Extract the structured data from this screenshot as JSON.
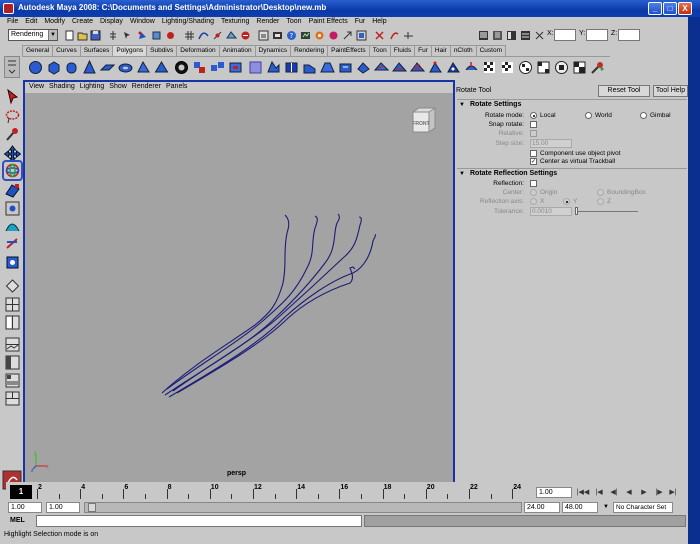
{
  "window": {
    "title": "Autodesk Maya 2008: C:\\Documents and Settings\\Administrator\\Desktop\\new.mb",
    "minimize": "_",
    "maximize": "□",
    "close": "X"
  },
  "menubar": [
    "File",
    "Edit",
    "Modify",
    "Create",
    "Display",
    "Window",
    "Lighting/Shading",
    "Texturing",
    "Render",
    "Toon",
    "Paint Effects",
    "Fur",
    "Help"
  ],
  "statusline": {
    "mode": "Rendering",
    "x_label": "X:",
    "y_label": "Y:",
    "z_label": "Z:"
  },
  "shelf_tabs": [
    "General",
    "Curves",
    "Surfaces",
    "Polygons",
    "Subdivs",
    "Deformation",
    "Animation",
    "Dynamics",
    "Rendering",
    "PaintEffects",
    "Toon",
    "Fluids",
    "Fur",
    "Hair",
    "nCloth",
    "Custom"
  ],
  "shelf_active_tab": "Polygons",
  "viewport": {
    "menu": [
      "View",
      "Shading",
      "Lighting",
      "Show",
      "Renderer",
      "Panels"
    ],
    "camera_label": "persp",
    "viewcube_label": "FRONT",
    "axis_y": "y",
    "axis_x": "x",
    "axis_z": "z"
  },
  "tool_settings": {
    "title": "Rotate Tool",
    "reset_button": "Reset Tool",
    "help_button": "Tool Help",
    "rotate_settings": {
      "header": "Rotate Settings",
      "rotate_mode_label": "Rotate mode:",
      "mode_local": "Local",
      "mode_world": "World",
      "mode_gimbal": "Gimbal",
      "snap_rotate_label": "Snap rotate:",
      "relative_label": "Relative:",
      "step_size_label": "Step size:",
      "step_size_value": "15.00",
      "component_pivot_label": "Component use object pivot",
      "virtual_trackball_label": "Center as virtual Trackball"
    },
    "reflection_settings": {
      "header": "Rotate Reflection Settings",
      "reflection_label": "Reflection:",
      "center_label": "Center:",
      "center_origin": "Origin",
      "center_bbox": "BoundingBox",
      "axis_label": "Reflection axis:",
      "axis_x": "X",
      "axis_y": "Y",
      "axis_z": "Z",
      "tolerance_label": "Tolerance:",
      "tolerance_value": "0.0010"
    }
  },
  "timeline": {
    "current_frame": "1",
    "ticks": [
      "2",
      "4",
      "6",
      "8",
      "10",
      "12",
      "14",
      "16",
      "18",
      "20",
      "22",
      "24"
    ],
    "current_frame_field": "1.00",
    "playback": [
      "|◀◀",
      "|◀",
      "◀|",
      "◀",
      "▶",
      "|▶",
      "▶|",
      "▶▶|"
    ]
  },
  "range": {
    "start_time": "1.00",
    "playback_start": "1.00",
    "playback_end": "24.00",
    "end_time": "48.00",
    "character_set": "No Character Set"
  },
  "command_line": {
    "label": "MEL"
  },
  "help_line": "Highlight Selection mode is on",
  "colors": {
    "title_bar": "#0a3aa8",
    "panel_grey": "#c8c8c8",
    "viewport_bg": "#a3a3a3",
    "viewport_frame": "#1634a8",
    "curve_color": "#1c1c7a"
  }
}
